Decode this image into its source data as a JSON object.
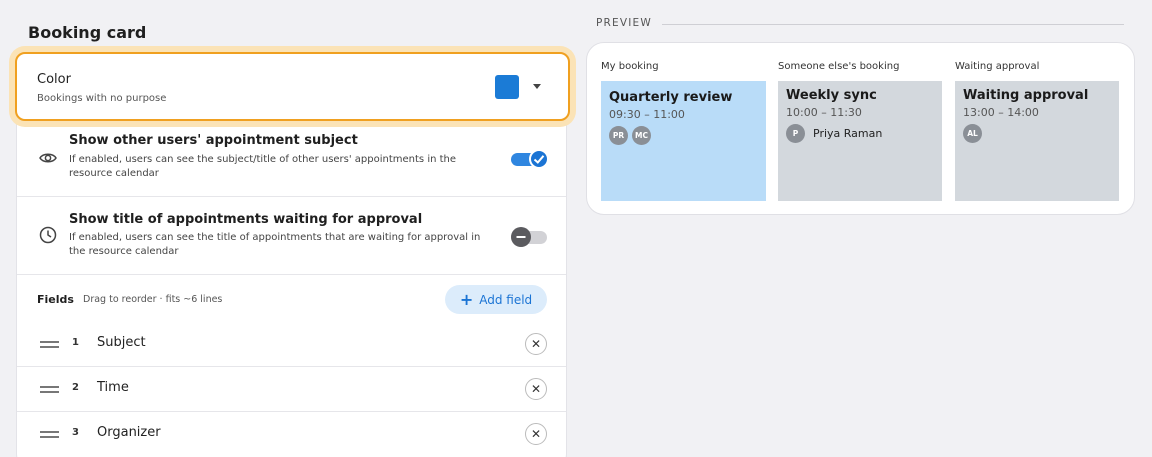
{
  "section": {
    "title": "Booking card"
  },
  "color": {
    "title": "Color",
    "subtitle": "Bookings with no purpose",
    "swatch": "#1b7bd6",
    "icon": "chevron-down-icon"
  },
  "settings": [
    {
      "title": "Show other users' appointment subject",
      "desc": "If enabled, users can see the subject/title of other users' appointments in the resource calendar",
      "icon": "eye-icon",
      "enabled": true
    },
    {
      "title": "Show title of appointments waiting for approval",
      "desc": "If enabled, users can see the title of appointments that are waiting for approval in the resource calendar",
      "icon": "clock-icon",
      "enabled": false
    }
  ],
  "fields": {
    "label": "Fields",
    "hint": "Drag to reorder · fits ~6 lines",
    "add_label": "Add field",
    "items": [
      {
        "num": "1",
        "name": "Subject"
      },
      {
        "num": "2",
        "name": "Time"
      },
      {
        "num": "3",
        "name": "Organizer"
      }
    ]
  },
  "preview": {
    "label": "PREVIEW",
    "columns": [
      {
        "label": "My booking",
        "title": "Quarterly review",
        "time": "09:30 – 11:00",
        "avatars": [
          "PR",
          "MC"
        ],
        "person": "",
        "bg": "#b9dcf8"
      },
      {
        "label": "Someone else's booking",
        "title": "Weekly sync",
        "time": "10:00 – 11:30",
        "avatars": [
          "P"
        ],
        "person": "Priya Raman",
        "bg": "#d3d8dd"
      },
      {
        "label": "Waiting approval",
        "title": "Waiting approval",
        "time": "13:00 – 14:00",
        "avatars": [
          "AL"
        ],
        "person": "",
        "bg": "#d3d8dd"
      }
    ]
  }
}
